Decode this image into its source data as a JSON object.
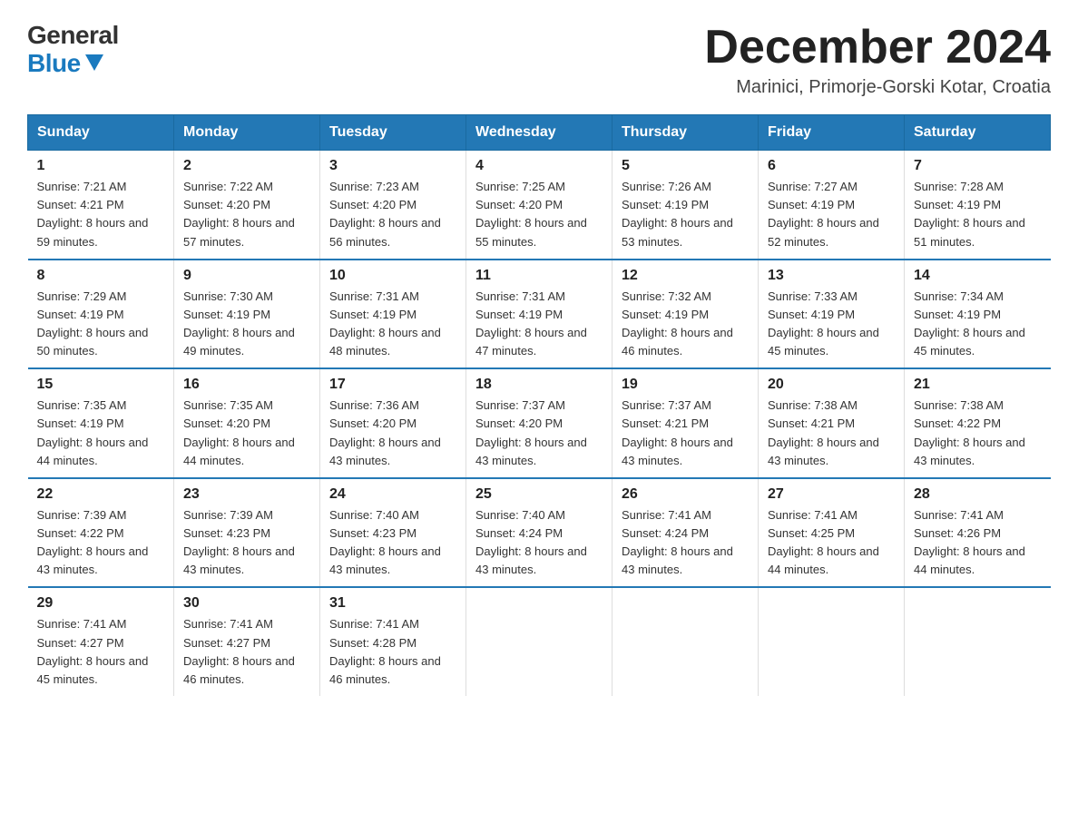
{
  "logo": {
    "general": "General",
    "blue": "Blue"
  },
  "header": {
    "month": "December 2024",
    "location": "Marinici, Primorje-Gorski Kotar, Croatia"
  },
  "days_of_week": [
    "Sunday",
    "Monday",
    "Tuesday",
    "Wednesday",
    "Thursday",
    "Friday",
    "Saturday"
  ],
  "weeks": [
    [
      {
        "day": "1",
        "sunrise": "7:21 AM",
        "sunset": "4:21 PM",
        "daylight": "8 hours and 59 minutes."
      },
      {
        "day": "2",
        "sunrise": "7:22 AM",
        "sunset": "4:20 PM",
        "daylight": "8 hours and 57 minutes."
      },
      {
        "day": "3",
        "sunrise": "7:23 AM",
        "sunset": "4:20 PM",
        "daylight": "8 hours and 56 minutes."
      },
      {
        "day": "4",
        "sunrise": "7:25 AM",
        "sunset": "4:20 PM",
        "daylight": "8 hours and 55 minutes."
      },
      {
        "day": "5",
        "sunrise": "7:26 AM",
        "sunset": "4:19 PM",
        "daylight": "8 hours and 53 minutes."
      },
      {
        "day": "6",
        "sunrise": "7:27 AM",
        "sunset": "4:19 PM",
        "daylight": "8 hours and 52 minutes."
      },
      {
        "day": "7",
        "sunrise": "7:28 AM",
        "sunset": "4:19 PM",
        "daylight": "8 hours and 51 minutes."
      }
    ],
    [
      {
        "day": "8",
        "sunrise": "7:29 AM",
        "sunset": "4:19 PM",
        "daylight": "8 hours and 50 minutes."
      },
      {
        "day": "9",
        "sunrise": "7:30 AM",
        "sunset": "4:19 PM",
        "daylight": "8 hours and 49 minutes."
      },
      {
        "day": "10",
        "sunrise": "7:31 AM",
        "sunset": "4:19 PM",
        "daylight": "8 hours and 48 minutes."
      },
      {
        "day": "11",
        "sunrise": "7:31 AM",
        "sunset": "4:19 PM",
        "daylight": "8 hours and 47 minutes."
      },
      {
        "day": "12",
        "sunrise": "7:32 AM",
        "sunset": "4:19 PM",
        "daylight": "8 hours and 46 minutes."
      },
      {
        "day": "13",
        "sunrise": "7:33 AM",
        "sunset": "4:19 PM",
        "daylight": "8 hours and 45 minutes."
      },
      {
        "day": "14",
        "sunrise": "7:34 AM",
        "sunset": "4:19 PM",
        "daylight": "8 hours and 45 minutes."
      }
    ],
    [
      {
        "day": "15",
        "sunrise": "7:35 AM",
        "sunset": "4:19 PM",
        "daylight": "8 hours and 44 minutes."
      },
      {
        "day": "16",
        "sunrise": "7:35 AM",
        "sunset": "4:20 PM",
        "daylight": "8 hours and 44 minutes."
      },
      {
        "day": "17",
        "sunrise": "7:36 AM",
        "sunset": "4:20 PM",
        "daylight": "8 hours and 43 minutes."
      },
      {
        "day": "18",
        "sunrise": "7:37 AM",
        "sunset": "4:20 PM",
        "daylight": "8 hours and 43 minutes."
      },
      {
        "day": "19",
        "sunrise": "7:37 AM",
        "sunset": "4:21 PM",
        "daylight": "8 hours and 43 minutes."
      },
      {
        "day": "20",
        "sunrise": "7:38 AM",
        "sunset": "4:21 PM",
        "daylight": "8 hours and 43 minutes."
      },
      {
        "day": "21",
        "sunrise": "7:38 AM",
        "sunset": "4:22 PM",
        "daylight": "8 hours and 43 minutes."
      }
    ],
    [
      {
        "day": "22",
        "sunrise": "7:39 AM",
        "sunset": "4:22 PM",
        "daylight": "8 hours and 43 minutes."
      },
      {
        "day": "23",
        "sunrise": "7:39 AM",
        "sunset": "4:23 PM",
        "daylight": "8 hours and 43 minutes."
      },
      {
        "day": "24",
        "sunrise": "7:40 AM",
        "sunset": "4:23 PM",
        "daylight": "8 hours and 43 minutes."
      },
      {
        "day": "25",
        "sunrise": "7:40 AM",
        "sunset": "4:24 PM",
        "daylight": "8 hours and 43 minutes."
      },
      {
        "day": "26",
        "sunrise": "7:41 AM",
        "sunset": "4:24 PM",
        "daylight": "8 hours and 43 minutes."
      },
      {
        "day": "27",
        "sunrise": "7:41 AM",
        "sunset": "4:25 PM",
        "daylight": "8 hours and 44 minutes."
      },
      {
        "day": "28",
        "sunrise": "7:41 AM",
        "sunset": "4:26 PM",
        "daylight": "8 hours and 44 minutes."
      }
    ],
    [
      {
        "day": "29",
        "sunrise": "7:41 AM",
        "sunset": "4:27 PM",
        "daylight": "8 hours and 45 minutes."
      },
      {
        "day": "30",
        "sunrise": "7:41 AM",
        "sunset": "4:27 PM",
        "daylight": "8 hours and 46 minutes."
      },
      {
        "day": "31",
        "sunrise": "7:41 AM",
        "sunset": "4:28 PM",
        "daylight": "8 hours and 46 minutes."
      },
      null,
      null,
      null,
      null
    ]
  ]
}
